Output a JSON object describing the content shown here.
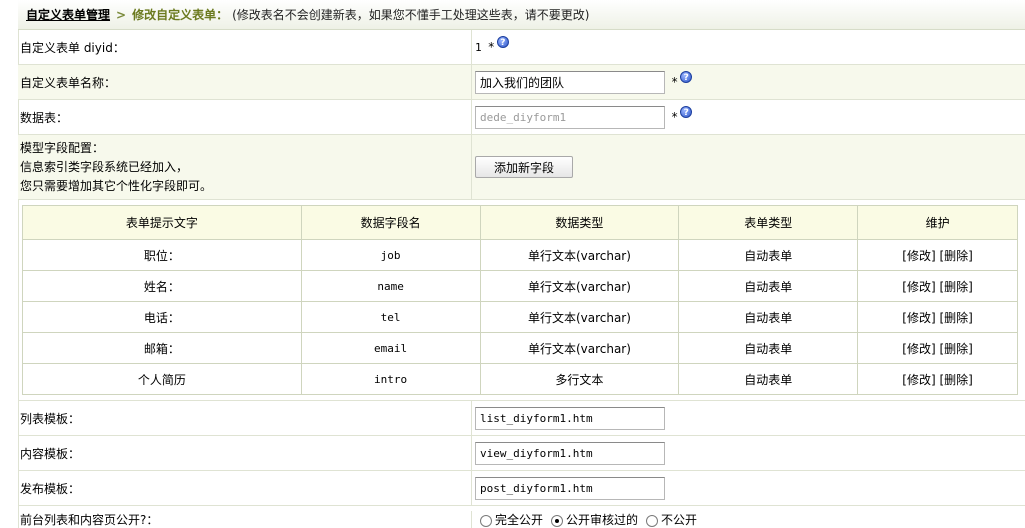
{
  "header": {
    "crumb_main": "自定义表单管理",
    "crumb_sep": ">",
    "crumb_current": "修改自定义表单：",
    "note": "(修改表名不会创建新表，如果您不懂手工处理这些表，请不要更改)"
  },
  "form": {
    "diyid": {
      "label": "自定义表单 diyid：",
      "value": "1",
      "required": "*"
    },
    "name": {
      "label": "自定义表单名称：",
      "value": "加入我们的团队",
      "required": "*"
    },
    "table": {
      "label": "数据表：",
      "value": "dede_diyform1",
      "required": "*"
    },
    "model_fields": {
      "label_line1": "模型字段配置：",
      "label_line2": "信息索引类字段系统已经加入，",
      "label_line3": "您只需要增加其它个性化字段即可。",
      "add_button": "添加新字段"
    },
    "list_template": {
      "label": "列表模板：",
      "value": "list_diyform1.htm"
    },
    "view_template": {
      "label": "内容模板：",
      "value": "view_diyform1.htm"
    },
    "post_template": {
      "label": "发布模板：",
      "value": "post_diyform1.htm"
    },
    "public": {
      "label": "前台列表和内容页公开?：",
      "options": [
        "完全公开",
        "公开审核过的",
        "不公开"
      ],
      "selected": "公开审核过的"
    }
  },
  "fields_table": {
    "headers": [
      "表单提示文字",
      "数据字段名",
      "数据类型",
      "表单类型",
      "维护"
    ],
    "rows": [
      {
        "label": "职位：",
        "field": "job",
        "type": "单行文本(varchar)",
        "form_type": "自动表单"
      },
      {
        "label": "姓名：",
        "field": "name",
        "type": "单行文本(varchar)",
        "form_type": "自动表单"
      },
      {
        "label": "电话：",
        "field": "tel",
        "type": "单行文本(varchar)",
        "form_type": "自动表单"
      },
      {
        "label": "邮箱：",
        "field": "email",
        "type": "单行文本(varchar)",
        "form_type": "自动表单"
      },
      {
        "label": "个人简历",
        "field": "intro",
        "type": "多行文本",
        "form_type": "自动表单"
      }
    ],
    "edit_link": "[修改]",
    "delete_link": "[删除]"
  },
  "icons": {
    "help": "help-icon"
  }
}
